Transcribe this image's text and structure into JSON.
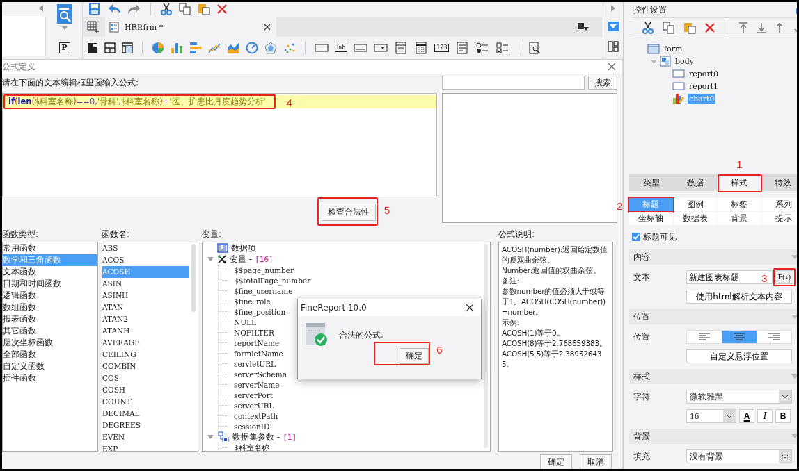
{
  "toolbar": {
    "document_tab": "HRP.frm *",
    "param_glyph": "P",
    "widgets": [
      {
        "kind": "button"
      },
      {
        "kind": "label",
        "glyph": "lab"
      },
      {
        "kind": "textfield"
      },
      {
        "kind": "combo"
      },
      {
        "kind": "panel"
      },
      {
        "kind": "calendar"
      },
      {
        "kind": "number",
        "glyph": "123"
      },
      {
        "kind": "textarea"
      },
      {
        "kind": "radio"
      },
      {
        "kind": "checkbox"
      }
    ]
  },
  "dialog": {
    "title": "公式定义",
    "prompt": "请在下面的文本编辑框里面输入公式:",
    "formula": {
      "marker": "4",
      "tokens": [
        {
          "kind": "keyword",
          "text": "if"
        },
        {
          "kind": "paren",
          "text": "("
        },
        {
          "kind": "keyword",
          "text": "len"
        },
        {
          "kind": "paren",
          "text": "("
        },
        {
          "kind": "variable",
          "text": "$科室名称"
        },
        {
          "kind": "paren",
          "text": ")"
        },
        {
          "kind": "operator",
          "text": "=="
        },
        {
          "kind": "number",
          "text": "0"
        },
        {
          "kind": "operator",
          "text": ","
        },
        {
          "kind": "string",
          "text": "'骨科'"
        },
        {
          "kind": "operator",
          "text": ","
        },
        {
          "kind": "variable",
          "text": "$科室名称"
        },
        {
          "kind": "paren",
          "text": ")"
        },
        {
          "kind": "operator",
          "text": "+"
        },
        {
          "kind": "string",
          "text": "'医、护患比月度趋势分析'"
        }
      ]
    },
    "search_button": "搜索",
    "check_button": {
      "label": "检查合法性",
      "marker": "5"
    },
    "function_types": {
      "label": "函数类型:",
      "items": [
        {
          "label": "常用函数",
          "selected": false
        },
        {
          "label": "数学和三角函数",
          "selected": true
        },
        {
          "label": "文本函数",
          "selected": false
        },
        {
          "label": "日期和时间函数",
          "selected": false
        },
        {
          "label": "逻辑函数",
          "selected": false
        },
        {
          "label": "数组函数",
          "selected": false
        },
        {
          "label": "报表函数",
          "selected": false
        },
        {
          "label": "其它函数",
          "selected": false
        },
        {
          "label": "层次坐标函数",
          "selected": false
        },
        {
          "label": "全部函数",
          "selected": false
        },
        {
          "label": "自定义函数",
          "selected": false
        },
        {
          "label": "插件函数",
          "selected": false
        }
      ]
    },
    "function_names": {
      "label": "函数名:",
      "items": [
        {
          "label": "ABS",
          "selected": false
        },
        {
          "label": "ACOS",
          "selected": false
        },
        {
          "label": "ACOSH",
          "selected": true
        },
        {
          "label": "ASIN",
          "selected": false
        },
        {
          "label": "ASINH",
          "selected": false
        },
        {
          "label": "ATAN",
          "selected": false
        },
        {
          "label": "ATAN2",
          "selected": false
        },
        {
          "label": "ATANH",
          "selected": false
        },
        {
          "label": "AVERAGE",
          "selected": false
        },
        {
          "label": "CEILING",
          "selected": false
        },
        {
          "label": "COMBIN",
          "selected": false
        },
        {
          "label": "COS",
          "selected": false
        },
        {
          "label": "COSH",
          "selected": false
        },
        {
          "label": "COUNT",
          "selected": false
        },
        {
          "label": "DECIMAL",
          "selected": false
        },
        {
          "label": "DEGREES",
          "selected": false
        },
        {
          "label": "EVEN",
          "selected": false
        },
        {
          "label": "EXP",
          "selected": false
        }
      ]
    },
    "variables": {
      "label": "变量:",
      "tree": [
        {
          "kind": "data_item",
          "name": "数据项"
        },
        {
          "kind": "variables",
          "name": "变量 -",
          "count": "[16]",
          "expanded": true,
          "children": [
            {
              "name": "$$page_number"
            },
            {
              "name": "$$totalPage_number"
            },
            {
              "name": "$fine_username"
            },
            {
              "name": "$fine_role"
            },
            {
              "name": "$fine_position"
            },
            {
              "name": "NULL"
            },
            {
              "name": "NOFILTER"
            },
            {
              "name": "reportName"
            },
            {
              "name": "formletName"
            },
            {
              "name": "servletURL"
            },
            {
              "name": "serverSchema"
            },
            {
              "name": "serverName"
            },
            {
              "name": "serverPort"
            },
            {
              "name": "serverURL"
            },
            {
              "name": "contextPath"
            },
            {
              "name": "sessionID"
            }
          ]
        },
        {
          "kind": "dataset",
          "name": "数据集参数 -",
          "count": "[1]",
          "expanded": true,
          "children": [
            {
              "name": "$科室名称"
            }
          ]
        }
      ]
    },
    "description": {
      "label": "公式说明:",
      "lines": [
        "ACOSH(number):返回给定数值的反双曲余弦。",
        "Number:返回值的双曲余弦。",
        "备注:",
        "参数number的值必须大于或等于1。ACOSH(COSH(number))=number。",
        "示例:",
        "ACOSH(1)等于0。",
        "ACOSH(8)等于2.768659383。",
        "ACOSH(5.5)等于2.389526435。"
      ]
    },
    "buttons": [
      "确定",
      "取消"
    ]
  },
  "popup": {
    "title": "FineReport 10.0",
    "message": "合法的公式.",
    "ok": {
      "label": "确定",
      "marker": "6"
    }
  },
  "panel": {
    "title": "控件设置",
    "tree": [
      {
        "name": "form",
        "kind": "form",
        "children": [
          {
            "name": "body",
            "kind": "body",
            "expanded": true,
            "children": [
              {
                "name": "report0",
                "kind": "report",
                "selected": false
              },
              {
                "name": "report1",
                "kind": "report",
                "selected": false
              },
              {
                "name": "chart0",
                "kind": "chart",
                "selected": true
              }
            ]
          }
        ]
      }
    ],
    "tabs": [
      {
        "label": "类型",
        "selected": false
      },
      {
        "label": "数据",
        "selected": false
      },
      {
        "label": "样式",
        "selected": true,
        "marker": "1"
      },
      {
        "label": "特效",
        "selected": false
      }
    ],
    "subtabs": [
      {
        "label": "标题",
        "selected": true,
        "marker": "2"
      },
      {
        "label": "图例",
        "selected": false
      },
      {
        "label": "标签",
        "selected": false
      },
      {
        "label": "系列",
        "selected": false
      },
      {
        "label": "坐标轴",
        "selected": false
      },
      {
        "label": "数据表",
        "selected": false
      },
      {
        "label": "背景",
        "selected": false
      },
      {
        "label": "提示",
        "selected": false
      }
    ],
    "title_visible": {
      "label": "标题可见",
      "checked": true
    },
    "content": {
      "title": "内容",
      "text_label": "文本",
      "text_value": "新建图表标题",
      "fx_button": {
        "label": "F(x)",
        "marker": "3"
      },
      "html_button": "使用html解析文本内容"
    },
    "position": {
      "title": "位置",
      "label": "位置",
      "alignments": [
        {
          "kind": "left",
          "selected": false
        },
        {
          "kind": "center",
          "selected": true
        },
        {
          "kind": "right",
          "selected": false
        }
      ],
      "float_button": "自定义悬浮位置"
    },
    "style": {
      "title": "样式",
      "font_label": "字符",
      "font": "微软雅黑",
      "size": "16",
      "color_glyph": "A",
      "italic_glyph": "I",
      "bold_glyph": "B"
    },
    "background": {
      "title": "背景",
      "fill_label": "填充",
      "fill": "没有背景"
    }
  }
}
